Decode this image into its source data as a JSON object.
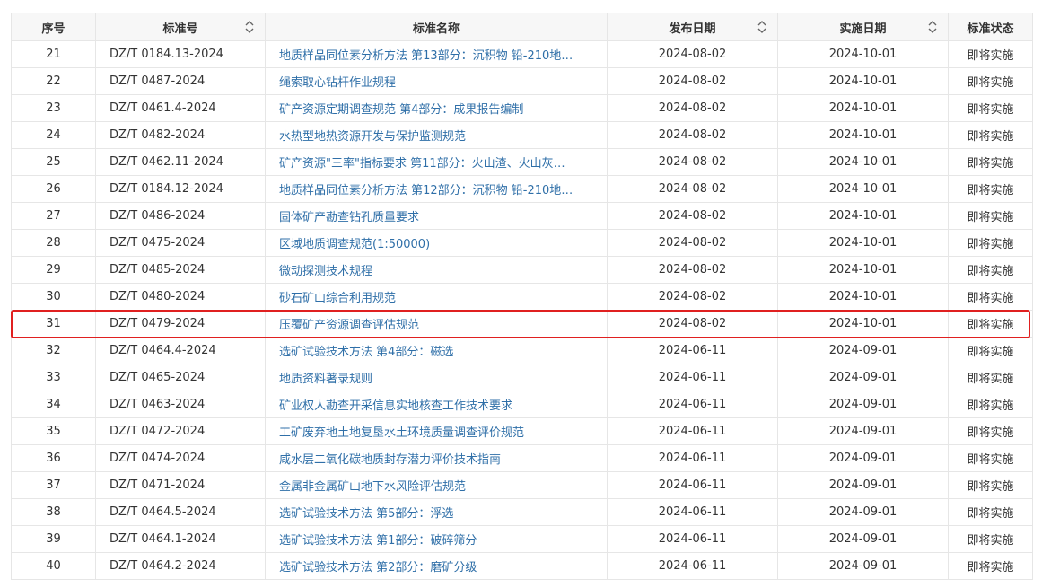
{
  "table": {
    "headers": {
      "index": "序号",
      "code": "标准号",
      "name": "标准名称",
      "publish_date": "发布日期",
      "effective_date": "实施日期",
      "status": "标准状态"
    },
    "sort_icon": "sort-updown-icon",
    "highlight_color": "#e02020",
    "link_color": "#2f6fa8",
    "highlighted_row_index": "31",
    "rows": [
      {
        "index": "21",
        "code": "DZ/T 0184.13-2024",
        "name": "地质样品同位素分析方法 第13部分：沉积物 铅-210地…",
        "publish": "2024-08-02",
        "effective": "2024-10-01",
        "status": "即将实施"
      },
      {
        "index": "22",
        "code": "DZ/T 0487-2024",
        "name": "绳索取心钻杆作业规程",
        "publish": "2024-08-02",
        "effective": "2024-10-01",
        "status": "即将实施"
      },
      {
        "index": "23",
        "code": "DZ/T 0461.4-2024",
        "name": "矿产资源定期调查规范 第4部分：成果报告编制",
        "publish": "2024-08-02",
        "effective": "2024-10-01",
        "status": "即将实施"
      },
      {
        "index": "24",
        "code": "DZ/T 0482-2024",
        "name": "水热型地热资源开发与保护监测规范",
        "publish": "2024-08-02",
        "effective": "2024-10-01",
        "status": "即将实施"
      },
      {
        "index": "25",
        "code": "DZ/T 0462.11-2024",
        "name": "矿产资源\"三率\"指标要求 第11部分：火山渣、火山灰…",
        "publish": "2024-08-02",
        "effective": "2024-10-01",
        "status": "即将实施"
      },
      {
        "index": "26",
        "code": "DZ/T 0184.12-2024",
        "name": "地质样品同位素分析方法 第12部分：沉积物 铅-210地…",
        "publish": "2024-08-02",
        "effective": "2024-10-01",
        "status": "即将实施"
      },
      {
        "index": "27",
        "code": "DZ/T 0486-2024",
        "name": "固体矿产勘查钻孔质量要求",
        "publish": "2024-08-02",
        "effective": "2024-10-01",
        "status": "即将实施"
      },
      {
        "index": "28",
        "code": "DZ/T 0475-2024",
        "name": "区域地质调查规范(1:50000)",
        "publish": "2024-08-02",
        "effective": "2024-10-01",
        "status": "即将实施"
      },
      {
        "index": "29",
        "code": "DZ/T 0485-2024",
        "name": "微动探测技术规程",
        "publish": "2024-08-02",
        "effective": "2024-10-01",
        "status": "即将实施"
      },
      {
        "index": "30",
        "code": "DZ/T 0480-2024",
        "name": "砂石矿山综合利用规范",
        "publish": "2024-08-02",
        "effective": "2024-10-01",
        "status": "即将实施"
      },
      {
        "index": "31",
        "code": "DZ/T 0479-2024",
        "name": "压覆矿产资源调查评估规范",
        "publish": "2024-08-02",
        "effective": "2024-10-01",
        "status": "即将实施"
      },
      {
        "index": "32",
        "code": "DZ/T 0464.4-2024",
        "name": "选矿试验技术方法 第4部分：磁选",
        "publish": "2024-06-11",
        "effective": "2024-09-01",
        "status": "即将实施"
      },
      {
        "index": "33",
        "code": "DZ/T 0465-2024",
        "name": "地质资料著录规则",
        "publish": "2024-06-11",
        "effective": "2024-09-01",
        "status": "即将实施"
      },
      {
        "index": "34",
        "code": "DZ/T 0463-2024",
        "name": "矿业权人勘查开采信息实地核查工作技术要求",
        "publish": "2024-06-11",
        "effective": "2024-09-01",
        "status": "即将实施"
      },
      {
        "index": "35",
        "code": "DZ/T 0472-2024",
        "name": "工矿废弃地土地复垦水土环境质量调查评价规范",
        "publish": "2024-06-11",
        "effective": "2024-09-01",
        "status": "即将实施"
      },
      {
        "index": "36",
        "code": "DZ/T 0474-2024",
        "name": "咸水层二氧化碳地质封存潜力评价技术指南",
        "publish": "2024-06-11",
        "effective": "2024-09-01",
        "status": "即将实施"
      },
      {
        "index": "37",
        "code": "DZ/T 0471-2024",
        "name": "金属非金属矿山地下水风险评估规范",
        "publish": "2024-06-11",
        "effective": "2024-09-01",
        "status": "即将实施"
      },
      {
        "index": "38",
        "code": "DZ/T 0464.5-2024",
        "name": "选矿试验技术方法 第5部分：浮选",
        "publish": "2024-06-11",
        "effective": "2024-09-01",
        "status": "即将实施"
      },
      {
        "index": "39",
        "code": "DZ/T 0464.1-2024",
        "name": "选矿试验技术方法 第1部分：破碎筛分",
        "publish": "2024-06-11",
        "effective": "2024-09-01",
        "status": "即将实施"
      },
      {
        "index": "40",
        "code": "DZ/T 0464.2-2024",
        "name": "选矿试验技术方法 第2部分：磨矿分级",
        "publish": "2024-06-11",
        "effective": "2024-09-01",
        "status": "即将实施"
      }
    ]
  }
}
